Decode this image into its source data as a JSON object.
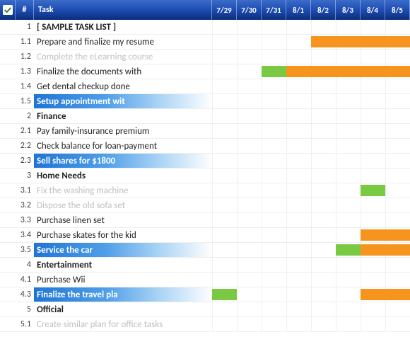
{
  "header": {
    "check_icon": "check",
    "num_label": "#",
    "task_label": "Task",
    "dates": [
      "7/29",
      "7/30",
      "7/31",
      "8/1",
      "8/2",
      "8/3",
      "8/4",
      "8/5"
    ]
  },
  "colors": {
    "orange": "#f7941e",
    "green": "#7ac943",
    "header_blue_start": "#3b6cc8",
    "header_blue_end": "#0b2d7a",
    "highlight_blue": "#1e75d8"
  },
  "rows": [
    {
      "num": "1",
      "task": "[ SAMPLE TASK LIST ]",
      "style": "header",
      "bars": []
    },
    {
      "num": "1.1",
      "task": "Prepare and finalize my resume",
      "style": "normal",
      "bars": [
        {
          "start": 4,
          "span": 4,
          "color": "orange"
        }
      ]
    },
    {
      "num": "1.2",
      "task": "Complete the eLearning course",
      "style": "completed",
      "bars": []
    },
    {
      "num": "1.3",
      "task": "Finalize the documents with",
      "style": "normal",
      "bars": [
        {
          "start": 2,
          "span": 1,
          "color": "green"
        },
        {
          "start": 3,
          "span": 5,
          "color": "orange"
        }
      ]
    },
    {
      "num": "1.4",
      "task": "Get dental checkup done",
      "style": "normal",
      "bars": []
    },
    {
      "num": "1.5",
      "task": "Setup appointment wit",
      "style": "highlighted",
      "bars": []
    },
    {
      "num": "2",
      "task": "Finance",
      "style": "header",
      "bars": []
    },
    {
      "num": "2.1",
      "task": "Pay family-insurance premium",
      "style": "normal",
      "bars": []
    },
    {
      "num": "2.2",
      "task": "Check balance for loan-payment",
      "style": "normal",
      "bars": []
    },
    {
      "num": "2.3",
      "task": "Sell shares for $1800",
      "style": "highlighted",
      "bars": []
    },
    {
      "num": "3",
      "task": "Home Needs",
      "style": "header",
      "bars": []
    },
    {
      "num": "3.1",
      "task": "Fix the washing machine",
      "style": "completed",
      "bars": [
        {
          "start": 6,
          "span": 1,
          "color": "green"
        }
      ]
    },
    {
      "num": "3.2",
      "task": "Dispose the old sofa set",
      "style": "completed",
      "bars": []
    },
    {
      "num": "3.3",
      "task": "Purchase linen set",
      "style": "normal",
      "bars": []
    },
    {
      "num": "3.4",
      "task": "Purchase skates for the kid",
      "style": "normal",
      "bars": [
        {
          "start": 6,
          "span": 2,
          "color": "orange"
        }
      ]
    },
    {
      "num": "3.5",
      "task": "Service the car",
      "style": "highlighted",
      "bars": [
        {
          "start": 5,
          "span": 1,
          "color": "green"
        },
        {
          "start": 6,
          "span": 2,
          "color": "orange"
        }
      ]
    },
    {
      "num": "4",
      "task": "Entertainment",
      "style": "header",
      "bars": []
    },
    {
      "num": "4.1",
      "task": "Purchase Wii",
      "style": "normal",
      "bars": []
    },
    {
      "num": "4.3",
      "task": "Finalize the travel pla",
      "style": "highlighted",
      "bars": [
        {
          "start": 0,
          "span": 1,
          "color": "green"
        },
        {
          "start": 6,
          "span": 2,
          "color": "orange"
        }
      ]
    },
    {
      "num": "5",
      "task": "Official",
      "style": "header",
      "bars": []
    },
    {
      "num": "5.1",
      "task": "Create similar plan for   office tasks",
      "style": "completed",
      "bars": []
    }
  ],
  "chart_data": {
    "type": "gantt",
    "x_categories": [
      "7/29",
      "7/30",
      "7/31",
      "8/1",
      "8/2",
      "8/3",
      "8/4",
      "8/5"
    ],
    "series": [
      {
        "name": "Prepare and finalize my resume",
        "start": "8/2",
        "end": "8/5",
        "color": "orange"
      },
      {
        "name": "Finalize the documents with",
        "start": "7/31",
        "end": "7/31",
        "color": "green"
      },
      {
        "name": "Finalize the documents with",
        "start": "8/1",
        "end": "8/5",
        "color": "orange"
      },
      {
        "name": "Fix the washing machine",
        "start": "8/4",
        "end": "8/4",
        "color": "green"
      },
      {
        "name": "Purchase skates for the kid",
        "start": "8/4",
        "end": "8/5",
        "color": "orange"
      },
      {
        "name": "Service the car",
        "start": "8/3",
        "end": "8/3",
        "color": "green"
      },
      {
        "name": "Service the car",
        "start": "8/4",
        "end": "8/5",
        "color": "orange"
      },
      {
        "name": "Finalize the travel pla",
        "start": "7/29",
        "end": "7/29",
        "color": "green"
      },
      {
        "name": "Finalize the travel pla",
        "start": "8/4",
        "end": "8/5",
        "color": "orange"
      }
    ]
  }
}
